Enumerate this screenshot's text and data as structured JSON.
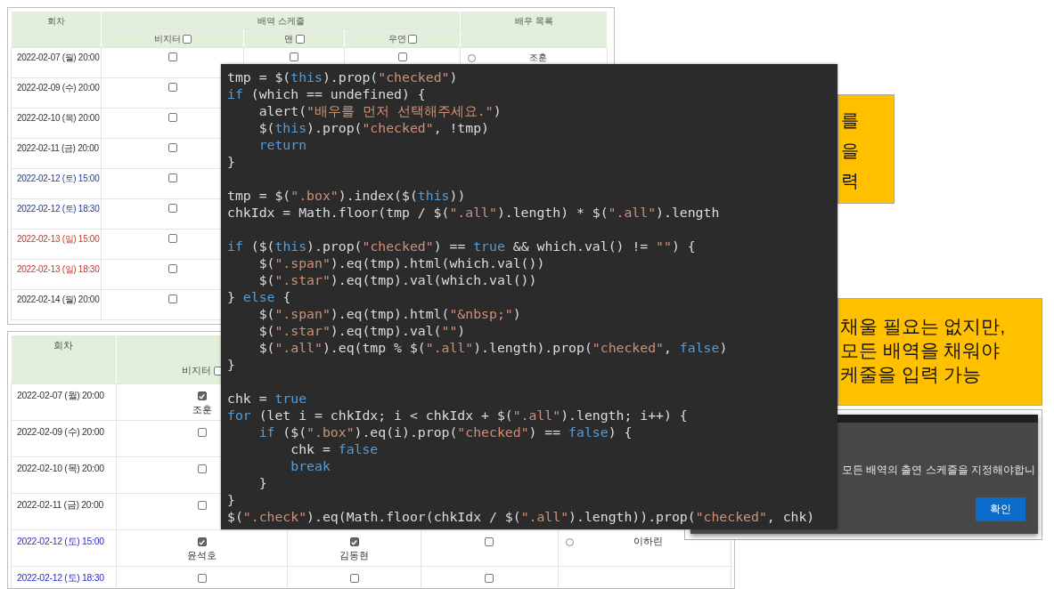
{
  "tables": [
    {
      "title_cells": {
        "round": "회차",
        "schedule": "배역 스케줄",
        "actors": "배우 목록"
      },
      "roles": [
        {
          "label": "비지터",
          "checked": false
        },
        {
          "label": "맨",
          "checked": false
        },
        {
          "label": "우연",
          "checked": false
        }
      ],
      "rows": [
        {
          "date": "2022-02-07 (월) 20:00",
          "kind": "weekday",
          "cells": [
            {
              "checked": false
            },
            {
              "checked": false
            },
            {
              "checked": false
            }
          ],
          "actor": {
            "name": "조훈",
            "selected": false
          }
        },
        {
          "date": "2022-02-09 (수) 20:00",
          "kind": "weekday",
          "cells": [
            {
              "checked": false
            }
          ]
        },
        {
          "date": "2022-02-10 (목) 20:00",
          "kind": "weekday",
          "cells": [
            {
              "checked": false
            }
          ]
        },
        {
          "date": "2022-02-11 (금) 20:00",
          "kind": "weekday",
          "cells": [
            {
              "checked": false
            }
          ]
        },
        {
          "date": "2022-02-12 (토) 15:00",
          "kind": "saturday",
          "cells": [
            {
              "checked": false
            }
          ]
        },
        {
          "date": "2022-02-12 (토) 18:30",
          "kind": "saturday",
          "cells": [
            {
              "checked": false
            }
          ]
        },
        {
          "date": "2022-02-13 (일) 15:00",
          "kind": "sunday",
          "cells": [
            {
              "checked": false
            }
          ]
        },
        {
          "date": "2022-02-13 (일) 18:30",
          "kind": "sunday",
          "cells": [
            {
              "checked": false
            }
          ]
        },
        {
          "date": "2022-02-14 (월) 20:00",
          "kind": "weekday",
          "cells": [
            {
              "checked": false
            }
          ]
        }
      ]
    },
    {
      "title_cells": {
        "round": "회차"
      },
      "roles": [
        {
          "label": "비지터",
          "checked": false
        }
      ],
      "rows": [
        {
          "date": "2022-02-07 (월) 20:00",
          "kind": "weekday",
          "cells": [
            {
              "checked": true,
              "name": "조훈"
            }
          ]
        },
        {
          "date": "2022-02-09 (수) 20:00",
          "kind": "weekday",
          "cells": [
            {
              "checked": false
            }
          ]
        },
        {
          "date": "2022-02-10 (목) 20:00",
          "kind": "weekday",
          "cells": [
            {
              "checked": false
            }
          ]
        },
        {
          "date": "2022-02-11 (금) 20:00",
          "kind": "weekday",
          "cells": [
            {
              "checked": false
            }
          ]
        },
        {
          "date": "2022-02-12 (토) 15:00",
          "kind": "saturday",
          "cells": [
            {
              "checked": true,
              "name": "윤석호"
            },
            {
              "checked": true,
              "name": "김동현"
            },
            {
              "checked": false
            }
          ],
          "actor": {
            "name": "이하린",
            "selected": false
          }
        },
        {
          "date": "2022-02-12 (토) 18:30",
          "kind": "saturday",
          "cells": [
            {
              "checked": false
            },
            {
              "checked": false
            },
            {
              "checked": false
            }
          ]
        }
      ]
    }
  ],
  "code": {
    "lines": [
      {
        "kind": "code",
        "tokens": [
          {
            "text": "tmp = $(",
            "kind": "plain"
          },
          {
            "text": "this",
            "kind": "keyword"
          },
          {
            "text": ").prop(",
            "kind": "plain"
          },
          {
            "text": "\"checked\"",
            "kind": "string"
          },
          {
            "text": ")",
            "kind": "plain"
          }
        ]
      },
      {
        "kind": "code",
        "tokens": [
          {
            "text": "if",
            "kind": "keyword"
          },
          {
            "text": " (which == undefined) {",
            "kind": "plain"
          }
        ]
      },
      {
        "kind": "code",
        "tokens": [
          {
            "text": "    alert(",
            "kind": "plain"
          },
          {
            "text": "\"배우를 먼저 선택해주세요.\"",
            "kind": "string"
          },
          {
            "text": ")",
            "kind": "plain"
          }
        ]
      },
      {
        "kind": "code",
        "tokens": [
          {
            "text": "    $(",
            "kind": "plain"
          },
          {
            "text": "this",
            "kind": "keyword"
          },
          {
            "text": ").prop(",
            "kind": "plain"
          },
          {
            "text": "\"checked\"",
            "kind": "string"
          },
          {
            "text": ", !tmp)",
            "kind": "plain"
          }
        ]
      },
      {
        "kind": "code",
        "tokens": [
          {
            "text": "    return",
            "kind": "keyword"
          }
        ]
      },
      {
        "kind": "code",
        "tokens": [
          {
            "text": "}",
            "kind": "plain"
          }
        ]
      },
      {
        "kind": "blank"
      },
      {
        "kind": "code",
        "tokens": [
          {
            "text": "tmp = $(",
            "kind": "plain"
          },
          {
            "text": "\".box\"",
            "kind": "string"
          },
          {
            "text": ").index($(",
            "kind": "plain"
          },
          {
            "text": "this",
            "kind": "keyword"
          },
          {
            "text": "))",
            "kind": "plain"
          }
        ]
      },
      {
        "kind": "code",
        "tokens": [
          {
            "text": "chkIdx = Math.floor(tmp / $(",
            "kind": "plain"
          },
          {
            "text": "\".all\"",
            "kind": "string"
          },
          {
            "text": ").length) * $(",
            "kind": "plain"
          },
          {
            "text": "\".all\"",
            "kind": "string"
          },
          {
            "text": ").length",
            "kind": "plain"
          }
        ]
      },
      {
        "kind": "blank"
      },
      {
        "kind": "code",
        "tokens": [
          {
            "text": "if",
            "kind": "keyword"
          },
          {
            "text": " ($(",
            "kind": "plain"
          },
          {
            "text": "this",
            "kind": "keyword"
          },
          {
            "text": ").prop(",
            "kind": "plain"
          },
          {
            "text": "\"checked\"",
            "kind": "string"
          },
          {
            "text": ") == ",
            "kind": "plain"
          },
          {
            "text": "true",
            "kind": "keyword"
          },
          {
            "text": " && which.val() != ",
            "kind": "plain"
          },
          {
            "text": "\"\"",
            "kind": "string"
          },
          {
            "text": ") {",
            "kind": "plain"
          }
        ]
      },
      {
        "kind": "code",
        "tokens": [
          {
            "text": "    $(",
            "kind": "plain"
          },
          {
            "text": "\".span\"",
            "kind": "string"
          },
          {
            "text": ").eq(tmp).html(which.val())",
            "kind": "plain"
          }
        ]
      },
      {
        "kind": "code",
        "tokens": [
          {
            "text": "    $(",
            "kind": "plain"
          },
          {
            "text": "\".star\"",
            "kind": "string"
          },
          {
            "text": ").eq(tmp).val(which.val())",
            "kind": "plain"
          }
        ]
      },
      {
        "kind": "code",
        "tokens": [
          {
            "text": "} ",
            "kind": "plain"
          },
          {
            "text": "else",
            "kind": "keyword"
          },
          {
            "text": " {",
            "kind": "plain"
          }
        ]
      },
      {
        "kind": "code",
        "tokens": [
          {
            "text": "    $(",
            "kind": "plain"
          },
          {
            "text": "\".span\"",
            "kind": "string"
          },
          {
            "text": ").eq(tmp).html(",
            "kind": "plain"
          },
          {
            "text": "\"&nbsp;\"",
            "kind": "string"
          },
          {
            "text": ")",
            "kind": "plain"
          }
        ]
      },
      {
        "kind": "code",
        "tokens": [
          {
            "text": "    $(",
            "kind": "plain"
          },
          {
            "text": "\".star\"",
            "kind": "string"
          },
          {
            "text": ").eq(tmp).val(",
            "kind": "plain"
          },
          {
            "text": "\"\"",
            "kind": "string"
          },
          {
            "text": ")",
            "kind": "plain"
          }
        ]
      },
      {
        "kind": "code",
        "tokens": [
          {
            "text": "    $(",
            "kind": "plain"
          },
          {
            "text": "\".all\"",
            "kind": "string"
          },
          {
            "text": ").eq(tmp % $(",
            "kind": "plain"
          },
          {
            "text": "\".all\"",
            "kind": "string"
          },
          {
            "text": ").length).prop(",
            "kind": "plain"
          },
          {
            "text": "\"checked\"",
            "kind": "string"
          },
          {
            "text": ", ",
            "kind": "plain"
          },
          {
            "text": "false",
            "kind": "keyword"
          },
          {
            "text": ")",
            "kind": "plain"
          }
        ]
      },
      {
        "kind": "code",
        "tokens": [
          {
            "text": "}",
            "kind": "plain"
          }
        ]
      },
      {
        "kind": "blank"
      },
      {
        "kind": "code",
        "tokens": [
          {
            "text": "chk = ",
            "kind": "plain"
          },
          {
            "text": "true",
            "kind": "keyword"
          }
        ]
      },
      {
        "kind": "code",
        "tokens": [
          {
            "text": "for",
            "kind": "keyword"
          },
          {
            "text": " (let i = chkIdx; i < chkIdx + $(",
            "kind": "plain"
          },
          {
            "text": "\".all\"",
            "kind": "string"
          },
          {
            "text": ").length; i++) {",
            "kind": "plain"
          }
        ]
      },
      {
        "kind": "code",
        "tokens": [
          {
            "text": "    if",
            "kind": "keyword"
          },
          {
            "text": " ($(",
            "kind": "plain"
          },
          {
            "text": "\".box\"",
            "kind": "string"
          },
          {
            "text": ").eq(i).prop(",
            "kind": "plain"
          },
          {
            "text": "\"checked\"",
            "kind": "string"
          },
          {
            "text": ") == ",
            "kind": "plain"
          },
          {
            "text": "false",
            "kind": "keyword"
          },
          {
            "text": ") {",
            "kind": "plain"
          }
        ]
      },
      {
        "kind": "code",
        "tokens": [
          {
            "text": "        chk = ",
            "kind": "plain"
          },
          {
            "text": "false",
            "kind": "keyword"
          }
        ]
      },
      {
        "kind": "code",
        "tokens": [
          {
            "text": "        break",
            "kind": "keyword"
          }
        ]
      },
      {
        "kind": "code",
        "tokens": [
          {
            "text": "    }",
            "kind": "plain"
          }
        ]
      },
      {
        "kind": "code",
        "tokens": [
          {
            "text": "}",
            "kind": "plain"
          }
        ]
      },
      {
        "kind": "code",
        "tokens": [
          {
            "text": "$(",
            "kind": "plain"
          },
          {
            "text": "\".check\"",
            "kind": "string"
          },
          {
            "text": ").eq(Math.floor(chkIdx / $(",
            "kind": "plain"
          },
          {
            "text": "\".all\"",
            "kind": "string"
          },
          {
            "text": ").length)).prop(",
            "kind": "plain"
          },
          {
            "text": "\"checked\"",
            "kind": "string"
          },
          {
            "text": ", chk)",
            "kind": "plain"
          }
        ]
      }
    ]
  },
  "notes": [
    {
      "lines": [
        "를",
        "을",
        "력"
      ]
    },
    {
      "lines": [
        "채울 필요는 없지만,",
        "모든 배역을 채워야",
        "케줄을 입력 가능"
      ]
    }
  ],
  "dialog": {
    "message": "모든 배역의 출연 스케줄을 지정해야합니",
    "button": "확인"
  }
}
